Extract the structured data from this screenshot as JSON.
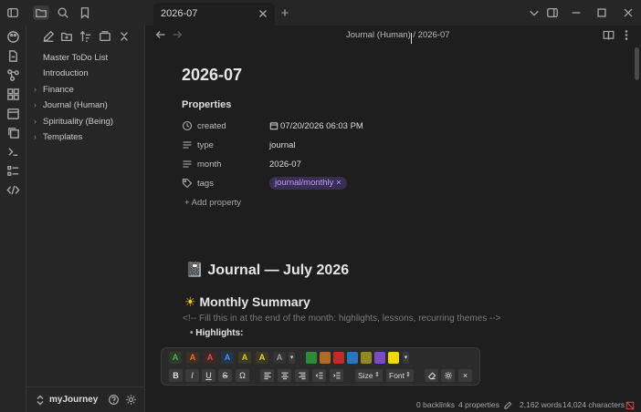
{
  "tab": {
    "title": "2026-07",
    "new_tab": "+"
  },
  "sidebar": {
    "items": [
      {
        "label": "Master ToDo List",
        "folder": false
      },
      {
        "label": "Introduction",
        "folder": false
      },
      {
        "label": "Finance",
        "folder": true
      },
      {
        "label": "Journal (Human)",
        "folder": true
      },
      {
        "label": "Spirituality (Being)",
        "folder": true
      },
      {
        "label": "Templates",
        "folder": true
      }
    ],
    "vault_name": "myJourney"
  },
  "breadcrumb": {
    "folder": "Journal (Human)",
    "separator": "/",
    "note": "2026-07"
  },
  "note": {
    "title": "2026-07",
    "properties_heading": "Properties",
    "properties": {
      "created": {
        "key": "created",
        "value": "07/20/2026 06:03 PM"
      },
      "type": {
        "key": "type",
        "value": "journal"
      },
      "month": {
        "key": "month",
        "value": "2026-07"
      },
      "tags": {
        "key": "tags",
        "value": "journal/monthly",
        "remove": "×"
      }
    },
    "add_property": "+ Add property",
    "heading": "Journal — July 2026",
    "heading_emoji": "📓",
    "section": "Monthly Summary",
    "section_emoji": "☀",
    "comment": "<!-- Fill this in at the end of the month: highlights, lessons, recurring themes -->",
    "bullet": "Highlights:"
  },
  "toolbar": {
    "text_colors": [
      {
        "letter": "A",
        "bg": "#2f3b2a",
        "fg": "#45b34d"
      },
      {
        "letter": "A",
        "bg": "#3d2f26",
        "fg": "#e0782c"
      },
      {
        "letter": "A",
        "bg": "#3d2828",
        "fg": "#e04a4a"
      },
      {
        "letter": "A",
        "bg": "#26344a",
        "fg": "#4a8fe0"
      },
      {
        "letter": "A",
        "bg": "#3b3a26",
        "fg": "#e0c42c"
      },
      {
        "letter": "A",
        "bg": "#3b3a26",
        "fg": "#f0d23a"
      },
      {
        "letter": "A",
        "bg": "#333333",
        "fg": "#9a9a9a"
      }
    ],
    "highlight_colors": [
      "#2e8b3a",
      "#b06a26",
      "#c02a2a",
      "#2a74c0",
      "#8f8a22",
      "#7a4cc0",
      "#f0d800"
    ],
    "bold": "B",
    "italic": "I",
    "underline": "U",
    "strike": "S",
    "omega": "Ω",
    "size_label": "Size",
    "font_label": "Font",
    "close": "×"
  },
  "status": {
    "backlinks": "0 backlinks",
    "properties": "4 properties",
    "words": "2,162 words",
    "characters": "14,024 characters"
  }
}
